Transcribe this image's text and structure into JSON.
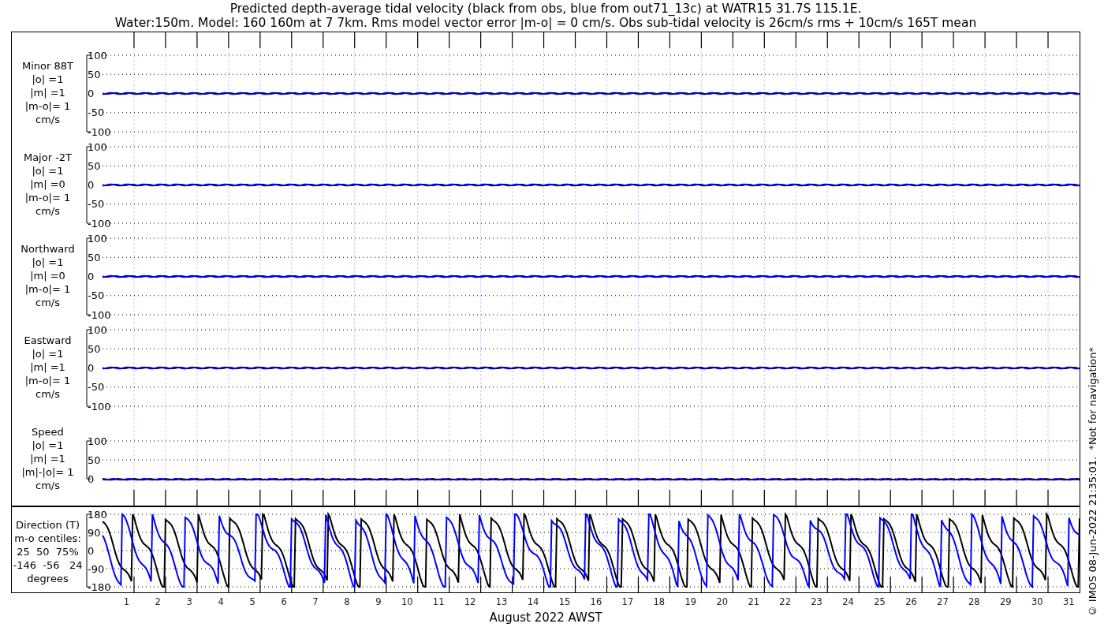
{
  "title": {
    "line_1": "Predicted depth-average tidal velocity (black from obs, blue from out71_13c) at WATR15 31.7S 115.1E.",
    "line_2": "Water:150m. Model: 160 160m at 7 7km. Rms model vector error |m-o| = 0 cm/s. Obs sub-tidal velocity is 26cm/s rms + 10cm/s 165T mean"
  },
  "panels": [
    {
      "kind": "velocity",
      "label_lines": [
        "Minor 88T",
        "|o| =1",
        "|m| =1",
        "|m-o|= 1",
        "cm/s"
      ],
      "yticks": [
        "100",
        "50",
        "0",
        "-50",
        "-100"
      ]
    },
    {
      "kind": "velocity",
      "label_lines": [
        "Major -2T",
        "|o| =1",
        "|m| =0",
        "|m-o|= 1",
        "cm/s"
      ],
      "yticks": [
        "100",
        "50",
        "0",
        "-50",
        "-100"
      ]
    },
    {
      "kind": "velocity",
      "label_lines": [
        "Northward",
        "|o| =1",
        "|m| =0",
        "|m-o|= 1",
        "cm/s"
      ],
      "yticks": [
        "100",
        "50",
        "0",
        "-50",
        "-100"
      ]
    },
    {
      "kind": "velocity",
      "label_lines": [
        "Eastward",
        "|o| =1",
        "|m| =1",
        "|m-o|= 1",
        "cm/s"
      ],
      "yticks": [
        "100",
        "50",
        "0",
        "-50",
        "-100"
      ]
    },
    {
      "kind": "speed",
      "label_lines": [
        "Speed",
        "|o| =1",
        "|m| =1",
        "|m|-|o|= 1",
        "cm/s"
      ],
      "yticks": [
        "100",
        "50",
        "0"
      ]
    },
    {
      "kind": "direction",
      "label_lines": [
        "Direction (T)",
        "m-o centiles:",
        "25  50  75%",
        "-146  -56   24",
        "degrees"
      ],
      "yticks": [
        "180",
        "90",
        "0",
        "-90",
        "-180"
      ]
    }
  ],
  "days": [
    "1",
    "2",
    "3",
    "4",
    "5",
    "6",
    "7",
    "8",
    "9",
    "10",
    "11",
    "12",
    "13",
    "14",
    "15",
    "16",
    "17",
    "18",
    "19",
    "20",
    "21",
    "22",
    "23",
    "24",
    "25",
    "26",
    "27",
    "28",
    "29",
    "30",
    "31"
  ],
  "xlabel": "August 2022 AWST",
  "side_note": "© IMOS 08-Jun-2022 21:35:01.  *Not for navigation*"
}
